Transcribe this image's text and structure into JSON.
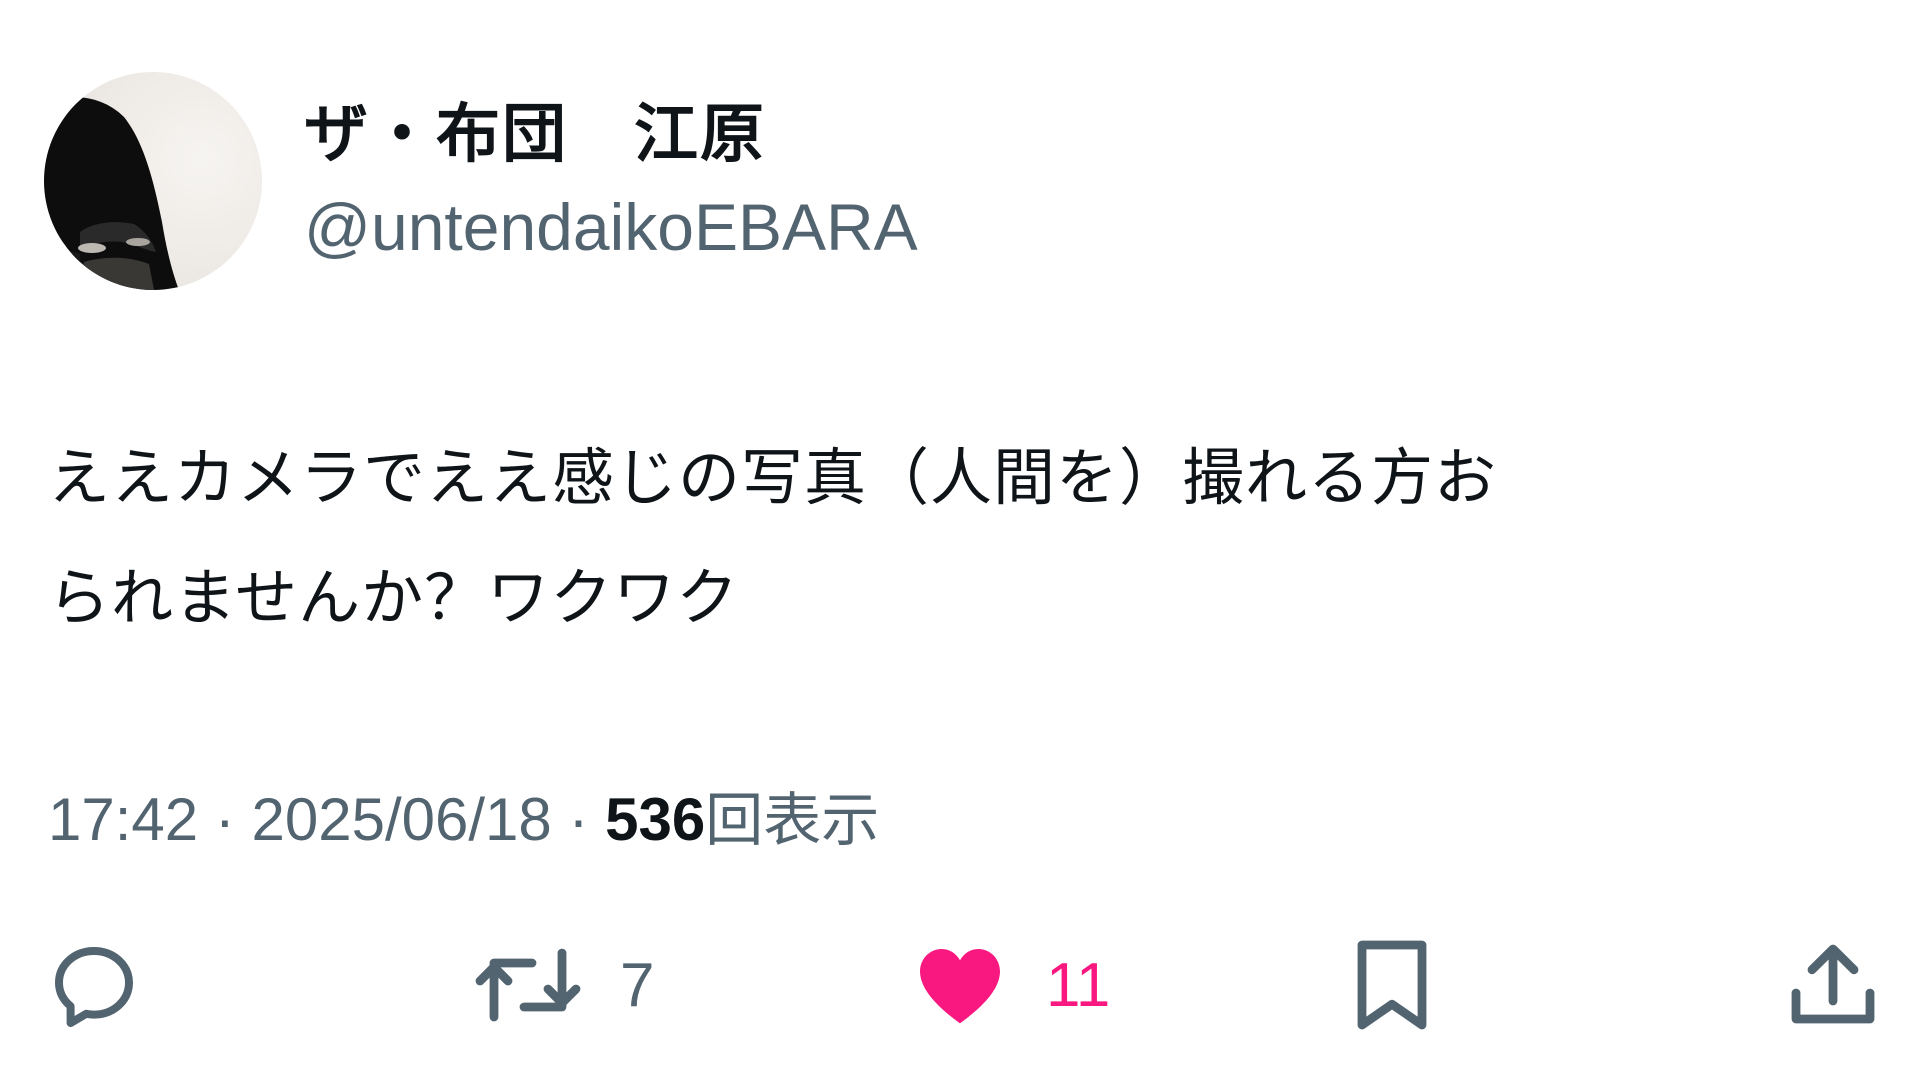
{
  "user": {
    "display_name": "ザ・布団　江原",
    "handle": "@untendaikoEBARA"
  },
  "tweet": {
    "lines": [
      "ええカメラでええ感じの写真（人間を）撮れる方お",
      "られませんか？ワクワク"
    ],
    "time": "17:42",
    "separator": " · ",
    "date": "2025/06/18",
    "views_count": "536",
    "views_label": "回表示"
  },
  "actions": {
    "reply": {
      "icon": "reply-icon",
      "count": ""
    },
    "retweet": {
      "icon": "retweet-icon",
      "count": "7"
    },
    "like": {
      "icon": "heart-icon",
      "count": "11",
      "liked": true
    },
    "bookmark": {
      "icon": "bookmark-icon"
    },
    "share": {
      "icon": "share-icon"
    }
  },
  "colors": {
    "text": "#0f1419",
    "secondary": "#536471",
    "like": "#f91880"
  }
}
